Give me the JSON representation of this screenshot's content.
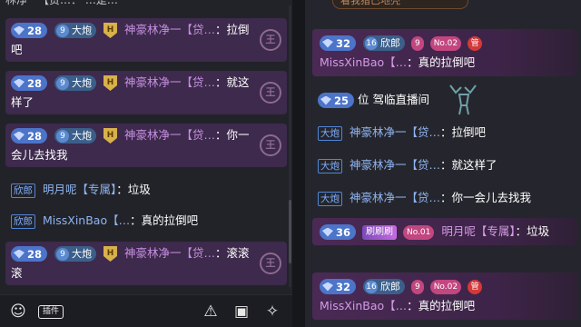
{
  "left": {
    "top_cut": "林净一【贷…：    …是…",
    "messages": [
      {
        "level": "28",
        "fan_level": "9",
        "fan_name": "大炮",
        "shield": "H",
        "user": "神豪林净一【贷…",
        "text": "：拉倒吧",
        "side_icon": "王"
      },
      {
        "level": "28",
        "fan_level": "9",
        "fan_name": "大炮",
        "shield": "H",
        "user": "神豪林净一【贷…",
        "text": "：就这样了",
        "side_icon": "王"
      },
      {
        "level": "28",
        "fan_level": "9",
        "fan_name": "大炮",
        "shield": "H",
        "user": "神豪林净一【贷…",
        "text": "：你一会儿去找我",
        "side_icon": "王"
      },
      {
        "tag": "欣郎",
        "user": "明月呢【专属】",
        "text": "：垃圾"
      },
      {
        "tag": "欣郎",
        "user": "MissXinBao【…",
        "text": "：真的拉倒吧"
      },
      {
        "level": "28",
        "fan_level": "9",
        "fan_name": "大炮",
        "shield": "H",
        "user": "神豪林净一【贷…",
        "text": "：滚滚滚",
        "side_icon": "王"
      }
    ],
    "toolbar": {
      "emoji_icon": "smile-icon",
      "tag_label": "插件",
      "warning_icon": "warning-icon",
      "gift_icon": "gift-card-icon",
      "setting_icon": "wand-icon"
    }
  },
  "right": {
    "top_banner": "看我猎已地壳",
    "card1": {
      "level": "32",
      "fan_level": "16",
      "fan_name": "欣郎",
      "badge2": "9",
      "rank": "No.02",
      "guan": "管",
      "user": "MissXinBao【…",
      "text": "：真的拉倒吧"
    },
    "enter": {
      "level": "25",
      "text": "位 驾临直播间"
    },
    "lines": [
      {
        "tag": "大炮",
        "user": "神豪林净一【贷…",
        "text": "：拉倒吧"
      },
      {
        "tag": "大炮",
        "user": "神豪林净一【贷…",
        "text": "：就这样了"
      },
      {
        "tag": "大炮",
        "user": "神豪林净一【贷…",
        "text": "：你一会儿去找我"
      }
    ],
    "card2": {
      "level": "36",
      "feng_badge": "刷刷刷",
      "rank": "No.01",
      "user": "明月呢【专属】",
      "text": "：垃圾"
    },
    "card3": {
      "level": "32",
      "fan_level": "16",
      "fan_name": "欣郎",
      "badge2": "9",
      "rank": "No.02",
      "guan": "管",
      "user": "MissXinBao【…",
      "text": "：真的拉倒吧"
    }
  }
}
